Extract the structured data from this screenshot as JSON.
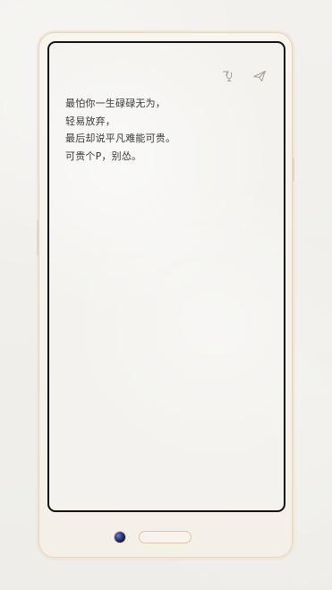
{
  "header": {
    "icons": [
      {
        "name": "voice-input-icon"
      },
      {
        "name": "send-icon"
      }
    ]
  },
  "note": {
    "lines": [
      "最怕你一生碌碌无为，",
      "轻易放弃，",
      "最后却说平凡难能可贵。",
      "可贵个P，别怂。"
    ]
  }
}
